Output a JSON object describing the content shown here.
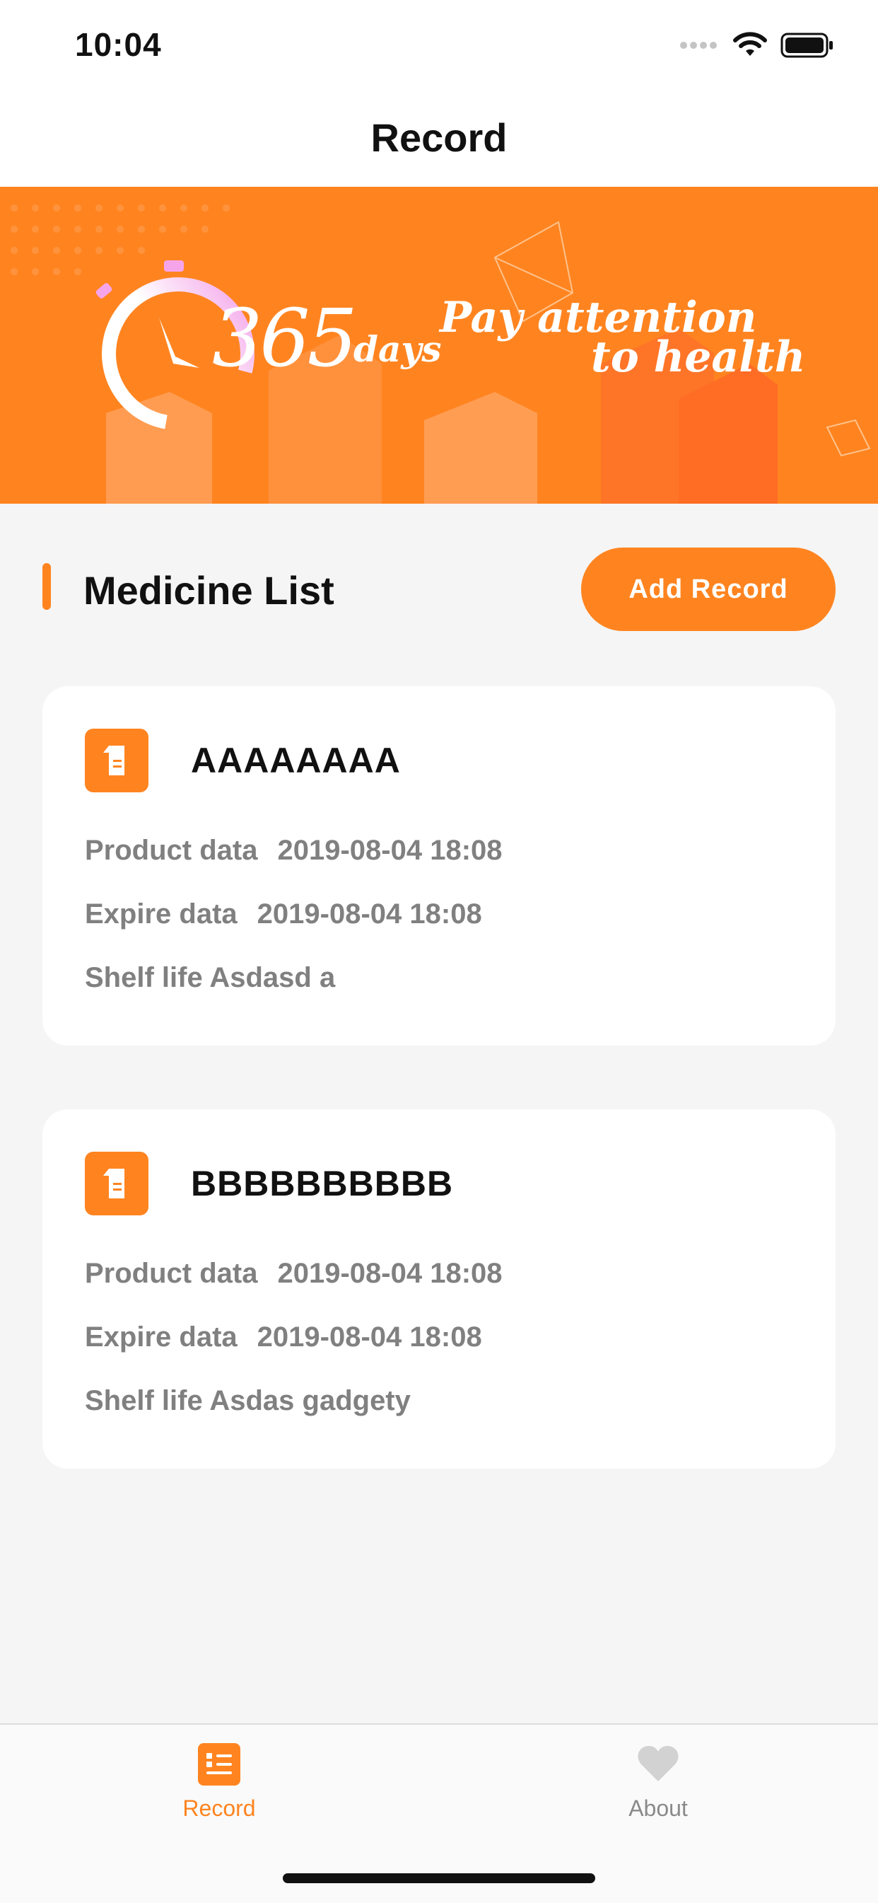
{
  "status_bar": {
    "time": "10:04"
  },
  "nav": {
    "title": "Record"
  },
  "banner": {
    "number": "365",
    "unit": "days",
    "slogan_line1": "Pay attention",
    "slogan_line2": "to health"
  },
  "section": {
    "title": "Medicine List",
    "add_button": "Add Record"
  },
  "records": [
    {
      "name": "AAAAAAAA",
      "product_label": "Product data",
      "product_value": "2019-08-04 18:08",
      "expire_label": "Expire data",
      "expire_value": "2019-08-04 18:08",
      "shelf_label": "Shelf life",
      "shelf_value": "Asdasd a"
    },
    {
      "name": "BBBBBBBBBB",
      "product_label": "Product data",
      "product_value": "2019-08-04 18:08",
      "expire_label": "Expire data",
      "expire_value": "2019-08-04 18:08",
      "shelf_label": "Shelf life",
      "shelf_value": "Asdas gadgety"
    }
  ],
  "tabs": [
    {
      "label": "Record",
      "icon": "list-icon",
      "active": true
    },
    {
      "label": "About",
      "icon": "heart-icon",
      "active": false
    }
  ],
  "colors": {
    "accent": "#ff8420",
    "inactive": "#8a8a8a",
    "text": "#111111",
    "muted": "#808080"
  }
}
